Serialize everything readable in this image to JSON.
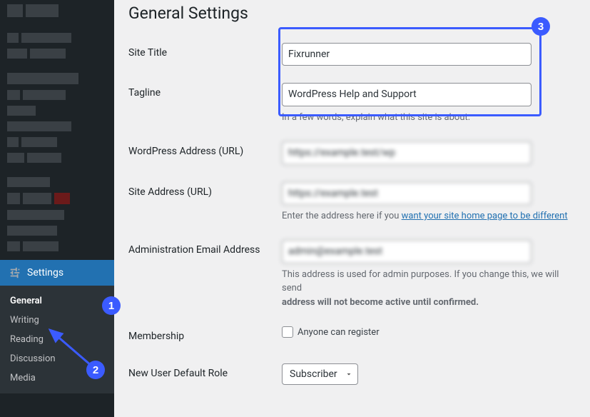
{
  "page": {
    "title": "General Settings"
  },
  "sidebar": {
    "settings_label": "Settings",
    "items": [
      "General",
      "Writing",
      "Reading",
      "Discussion",
      "Media"
    ]
  },
  "fields": {
    "site_title": {
      "label": "Site Title",
      "value": "Fixrunner"
    },
    "tagline": {
      "label": "Tagline",
      "value": "WordPress Help and Support",
      "hint": "In a few words, explain what this site is about."
    },
    "wp_url": {
      "label": "WordPress Address (URL)"
    },
    "site_url": {
      "label": "Site Address (URL)",
      "hint_pre": "Enter the address here if you ",
      "hint_link": "want your site home page to be different"
    },
    "admin_email": {
      "label": "Administration Email Address",
      "hint": "This address is used for admin purposes. If you change this, we will send",
      "hint2": "address will not become active until confirmed."
    },
    "membership": {
      "label": "Membership",
      "checkbox_label": "Anyone can register"
    },
    "default_role": {
      "label": "New User Default Role",
      "value": "Subscriber"
    }
  },
  "badges": {
    "b1": "1",
    "b2": "2",
    "b3": "3"
  }
}
